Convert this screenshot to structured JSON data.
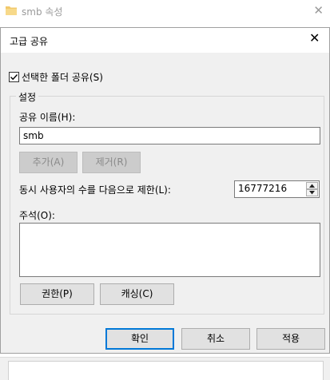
{
  "background_window": {
    "title": "smb 속성",
    "icon": "folder-icon"
  },
  "dialog": {
    "title": "고급 공유",
    "close_icon": "close-icon",
    "share_checkbox": {
      "label": "선택한 폴더 공유(S)",
      "checked": true
    },
    "settings_group": {
      "label": "설정",
      "share_name_label": "공유 이름(H):",
      "share_name_value": "smb",
      "add_button": "추가(A)",
      "remove_button": "제거(R)",
      "user_limit_label": "동시 사용자의 수를 다음으로 제한(L):",
      "user_limit_value": "16777216",
      "comment_label": "주석(O):",
      "comment_value": "",
      "permissions_button": "권한(P)",
      "caching_button": "캐싱(C)"
    },
    "ok_button": "확인",
    "cancel_button": "취소",
    "apply_button": "적용"
  },
  "colors": {
    "accent": "#0078d7",
    "dialog_bg": "#f0f0f0",
    "disabled_button_bg": "#cccccc"
  }
}
